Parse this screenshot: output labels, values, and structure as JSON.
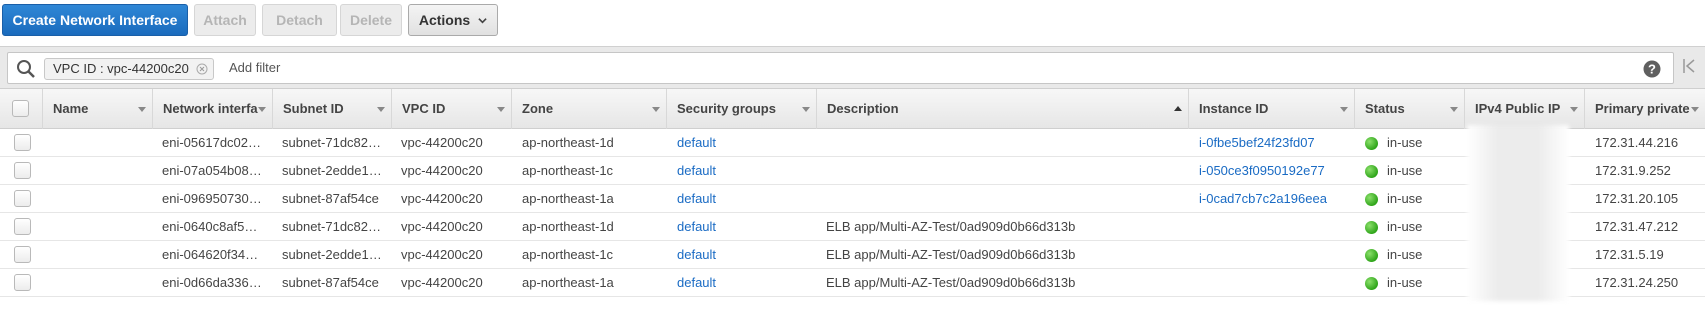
{
  "toolbar": {
    "create_label": "Create Network Interface",
    "attach_label": "Attach",
    "detach_label": "Detach",
    "delete_label": "Delete",
    "actions_label": "Actions"
  },
  "filter": {
    "chip_label": "VPC ID : vpc-44200c20",
    "placeholder": "Add filter"
  },
  "columns": {
    "name": "Name",
    "network_interface": "Network interfa",
    "subnet": "Subnet ID",
    "vpc": "VPC ID",
    "zone": "Zone",
    "security_groups": "Security groups",
    "description": "Description",
    "instance": "Instance ID",
    "status": "Status",
    "ipv4_public": "IPv4 Public IP",
    "primary_private": "Primary private"
  },
  "rows": [
    {
      "eni": "eni-05617dc02…",
      "subnet": "subnet-71dc82…",
      "vpc": "vpc-44200c20",
      "zone": "ap-northeast-1d",
      "sg": "default",
      "description": "",
      "instance": "i-0fbe5bef24f23fd07",
      "status": "in-use",
      "private_ip": "172.31.44.216"
    },
    {
      "eni": "eni-07a054b08…",
      "subnet": "subnet-2edde1…",
      "vpc": "vpc-44200c20",
      "zone": "ap-northeast-1c",
      "sg": "default",
      "description": "",
      "instance": "i-050ce3f0950192e77",
      "status": "in-use",
      "private_ip": "172.31.9.252"
    },
    {
      "eni": "eni-096950730…",
      "subnet": "subnet-87af54ce",
      "vpc": "vpc-44200c20",
      "zone": "ap-northeast-1a",
      "sg": "default",
      "description": "",
      "instance": "i-0cad7cb7c2a196eea",
      "status": "in-use",
      "private_ip": "172.31.20.105"
    },
    {
      "eni": "eni-0640c8af5…",
      "subnet": "subnet-71dc82…",
      "vpc": "vpc-44200c20",
      "zone": "ap-northeast-1d",
      "sg": "default",
      "description": "ELB app/Multi-AZ-Test/0ad909d0b66d313b",
      "instance": "",
      "status": "in-use",
      "private_ip": "172.31.47.212"
    },
    {
      "eni": "eni-064620f34…",
      "subnet": "subnet-2edde1…",
      "vpc": "vpc-44200c20",
      "zone": "ap-northeast-1c",
      "sg": "default",
      "description": "ELB app/Multi-AZ-Test/0ad909d0b66d313b",
      "instance": "",
      "status": "in-use",
      "private_ip": "172.31.5.19"
    },
    {
      "eni": "eni-0d66da336…",
      "subnet": "subnet-87af54ce",
      "vpc": "vpc-44200c20",
      "zone": "ap-northeast-1a",
      "sg": "default",
      "description": "ELB app/Multi-AZ-Test/0ad909d0b66d313b",
      "instance": "",
      "status": "in-use",
      "private_ip": "172.31.24.250"
    }
  ],
  "colors": {
    "primary": "#1a6bbd",
    "link": "#1a6bc4",
    "status_ok": "#2fa51a"
  },
  "icons": {
    "search": "search-icon",
    "chip_close": "close-icon",
    "help": "help-icon",
    "collapse": "collapse-panel-icon",
    "caret": "chevron-down-icon"
  }
}
